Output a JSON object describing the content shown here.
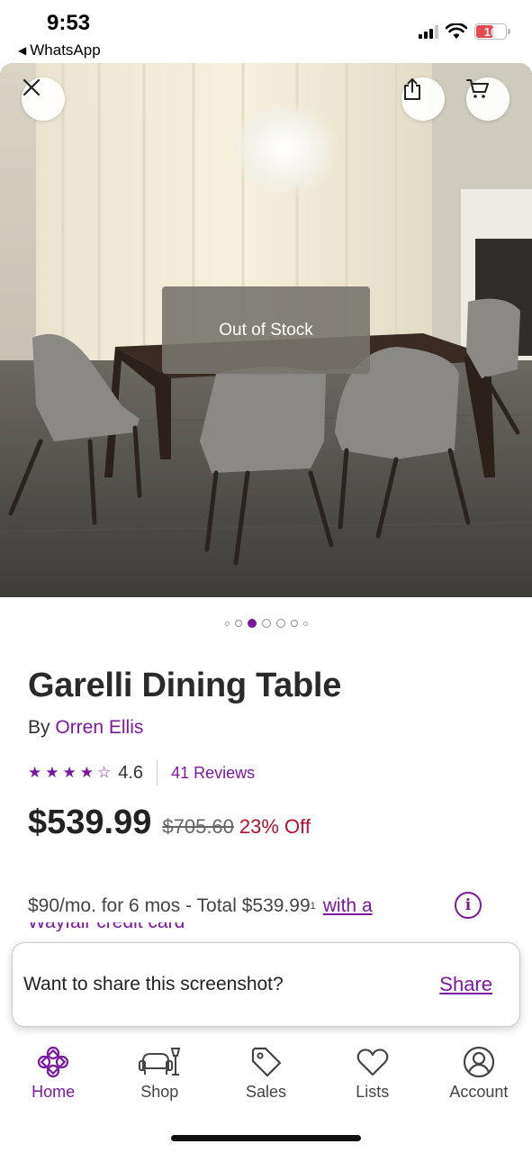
{
  "status_bar": {
    "time": "9:53",
    "back_app": "WhatsApp",
    "battery": "16"
  },
  "hero": {
    "overlay_text": "Out of Stock",
    "carousel_count": 7,
    "carousel_active_index": 2
  },
  "product": {
    "title": "Garelli Dining Table",
    "by_prefix": "By",
    "brand": "Orren Ellis",
    "rating": "4.6",
    "rating_value": 4.6,
    "reviews": "41 Reviews",
    "price": "$539.99",
    "old_price": "$705.60",
    "discount": "23% Off",
    "finance_text": "$90/mo. for 6 mos - Total $539.99",
    "finance_superscript": "1",
    "finance_link": "with a",
    "finance_link_cut": "Wayfair credit card"
  },
  "toast": {
    "text": "Want to share this screenshot?",
    "action": "Share"
  },
  "nav": {
    "items": [
      {
        "label": "Home",
        "icon": "home-icon",
        "active": true
      },
      {
        "label": "Shop",
        "icon": "shop-icon",
        "active": false
      },
      {
        "label": "Sales",
        "icon": "tag-icon",
        "active": false
      },
      {
        "label": "Lists",
        "icon": "heart-icon",
        "active": false
      },
      {
        "label": "Account",
        "icon": "account-icon",
        "active": false
      }
    ]
  },
  "colors": {
    "accent": "#7b189f",
    "discount": "#b0122f"
  }
}
